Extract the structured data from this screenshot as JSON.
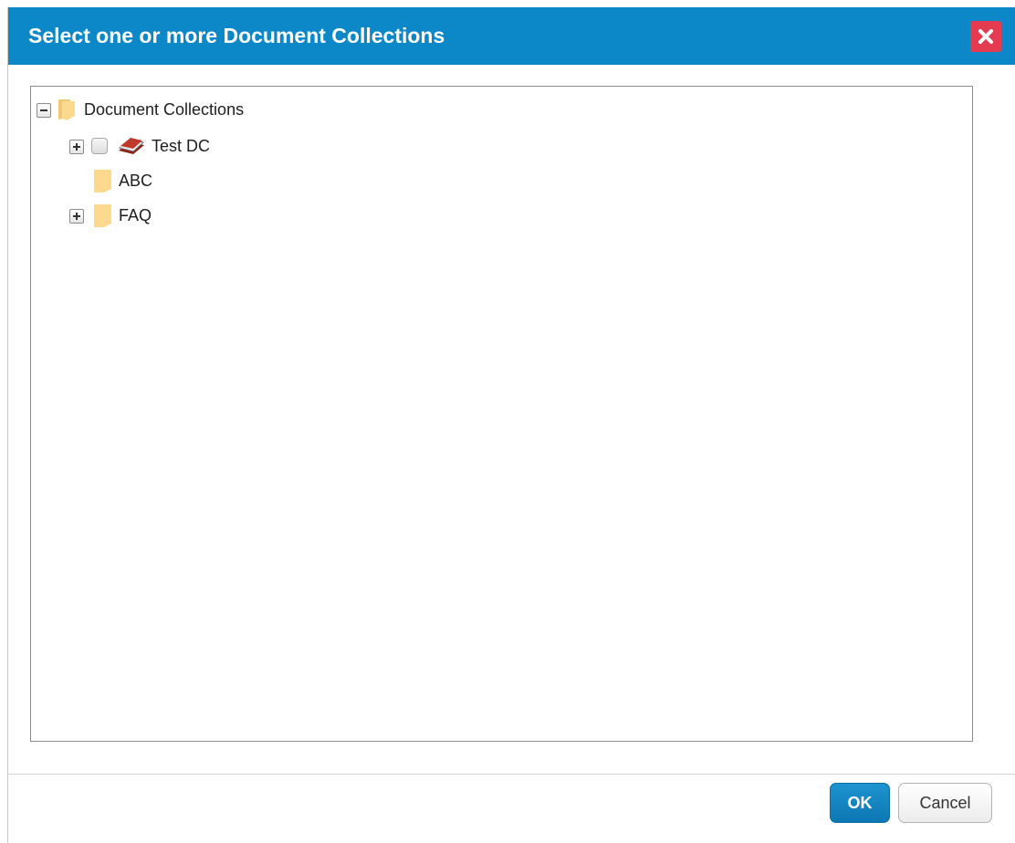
{
  "dialog": {
    "title": "Select one or more Document Collections",
    "close_icon": "close-icon",
    "ok_label": "OK",
    "cancel_label": "Cancel",
    "colors": {
      "titlebar": "#0c88c8",
      "close": "#e43b50",
      "ok": "#1485c2",
      "folder": "#fcd98f",
      "book": "#c0392b"
    }
  },
  "tree": {
    "root": {
      "label": "Document Collections",
      "state": "expanded",
      "icon": "folder-open-icon"
    },
    "items": [
      {
        "label": "Test DC",
        "state": "collapsed",
        "checkbox": true,
        "checked": false,
        "icon": "books-icon"
      },
      {
        "label": "ABC",
        "state": "leaf",
        "icon": "folder-icon"
      },
      {
        "label": "FAQ",
        "state": "collapsed",
        "icon": "folder-icon"
      }
    ]
  }
}
